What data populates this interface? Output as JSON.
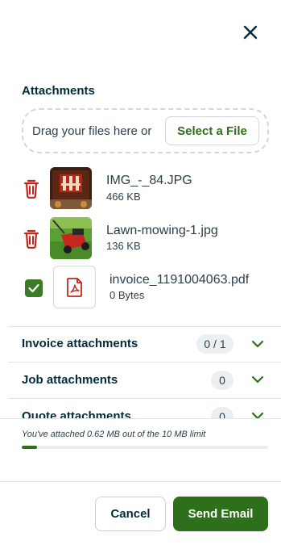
{
  "header": {
    "close_icon": "close-icon"
  },
  "attachments": {
    "title": "Attachments",
    "dropzone_text": "Drag your files here or",
    "select_file_label": "Select a File",
    "files": [
      {
        "name": "IMG_-_84.JPG",
        "size": "466 KB",
        "icon": "trash-icon",
        "selected": false
      },
      {
        "name": "Lawn-mowing-1.jpg",
        "size": "136 KB",
        "icon": "trash-icon",
        "selected": false
      },
      {
        "name": "invoice_1191004063.pdf",
        "size": "0 Bytes",
        "icon": "pdf-icon",
        "selected": true
      }
    ]
  },
  "sections": [
    {
      "label": "Invoice attachments",
      "count": "0 / 1"
    },
    {
      "label": "Job attachments",
      "count": "0"
    },
    {
      "label": "Quote attachments",
      "count": "0"
    }
  ],
  "limit": {
    "text": "You've attached 0.62 MB out of the 10 MB limit",
    "used_mb": 0.62,
    "max_mb": 10
  },
  "footer": {
    "cancel_label": "Cancel",
    "send_label": "Send Email"
  },
  "colors": {
    "primary_green": "#2e6f1b",
    "danger_red": "#c0261d",
    "text_dark": "#032b3a"
  }
}
